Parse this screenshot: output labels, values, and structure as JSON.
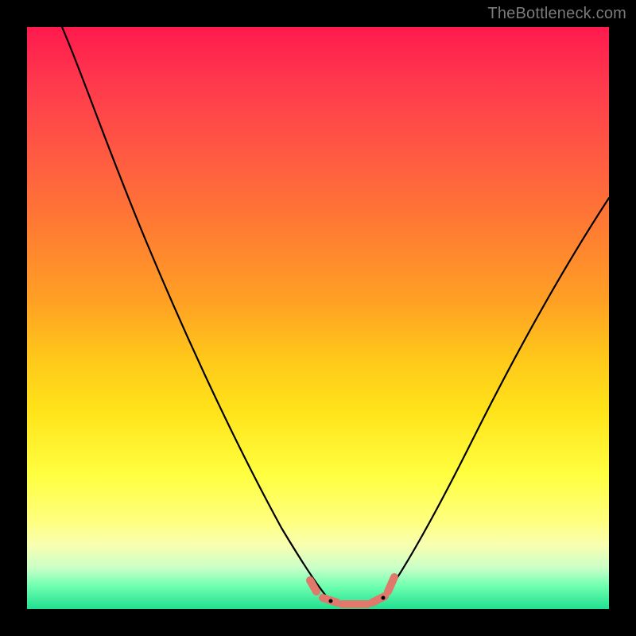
{
  "watermark": {
    "text": "TheBottleneck.com"
  },
  "chart_data": {
    "type": "line",
    "title": "",
    "xlabel": "",
    "ylabel": "",
    "xlim": [
      0,
      100
    ],
    "ylim": [
      0,
      100
    ],
    "grid": false,
    "series": [
      {
        "name": "left-curve",
        "stroke": "#000000",
        "x": [
          6,
          12,
          18,
          24,
          30,
          36,
          42,
          46,
          50,
          52
        ],
        "y": [
          100,
          82,
          65,
          49,
          35,
          22,
          12,
          6,
          2,
          1
        ]
      },
      {
        "name": "right-curve",
        "stroke": "#000000",
        "x": [
          60,
          64,
          70,
          76,
          82,
          88,
          94,
          100
        ],
        "y": [
          1,
          4,
          12,
          23,
          35,
          48,
          60,
          70
        ]
      },
      {
        "name": "flat-bottom-marker",
        "stroke": "#e0786c",
        "x": [
          48,
          50,
          52,
          54,
          56,
          58,
          60,
          62
        ],
        "y": [
          4,
          2,
          1,
          0.5,
          0.5,
          0.5,
          1,
          4
        ]
      }
    ]
  }
}
